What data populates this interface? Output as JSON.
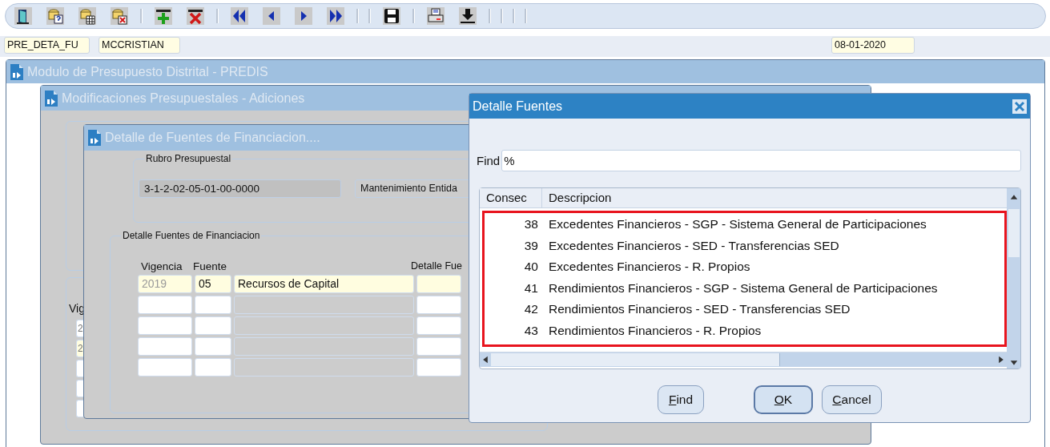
{
  "toolbar": {
    "fields": [
      {
        "value": "PRE_DETA_FU"
      },
      {
        "value": "MCCRISTIAN"
      }
    ],
    "date": "08-01-2020"
  },
  "main_window": {
    "title": "Modulo de Presupuesto Distrital - PREDIS",
    "active": false
  },
  "adiciones_window": {
    "title": "Modificaciones Presupuestales - Adiciones",
    "active": false,
    "partial_label": "Vig",
    "partial_cells": [
      "2",
      "2"
    ]
  },
  "detalle_window": {
    "title": "Detalle de Fuentes de Financiacion....",
    "active": false,
    "rubro": {
      "legend": "Rubro Presupuestal",
      "code": "3-1-2-02-05-01-00-0000",
      "name": "Mantenimiento Entida"
    },
    "fuentes": {
      "legend": "Detalle Fuentes de Financiacion",
      "columns": [
        "Vigencia",
        "Fuente",
        "Detalle Fue"
      ],
      "rows": [
        {
          "current": true,
          "vigencia": "2019",
          "fuente": "05",
          "descripcion": "Recursos de Capital"
        },
        {
          "current": false
        },
        {
          "current": false
        },
        {
          "current": false
        },
        {
          "current": false
        }
      ]
    }
  },
  "dialog": {
    "title": "Detalle Fuentes",
    "active": true,
    "find_label": "Find",
    "find_value": "%",
    "columns": [
      "Consec",
      "Descripcion"
    ],
    "rows": [
      {
        "consec": "38",
        "descripcion": "Excedentes Financieros - SGP - Sistema General de Participaciones"
      },
      {
        "consec": "39",
        "descripcion": "Excedentes Financieros - SED - Transferencias SED"
      },
      {
        "consec": "40",
        "descripcion": "Excedentes Financieros - R. Propios"
      },
      {
        "consec": "41",
        "descripcion": "Rendimientos Financieros - SGP - Sistema General de Participaciones"
      },
      {
        "consec": "42",
        "descripcion": "Rendimientos Financieros - SED - Transferencias SED"
      },
      {
        "consec": "43",
        "descripcion": "Rendimientos Financieros - R. Propios"
      }
    ],
    "annotation": {
      "kind": "outline"
    },
    "buttons": [
      {
        "label": "Find",
        "default": false
      },
      {
        "label": "OK",
        "default": true
      },
      {
        "label": "Cancel",
        "default": false
      }
    ]
  }
}
